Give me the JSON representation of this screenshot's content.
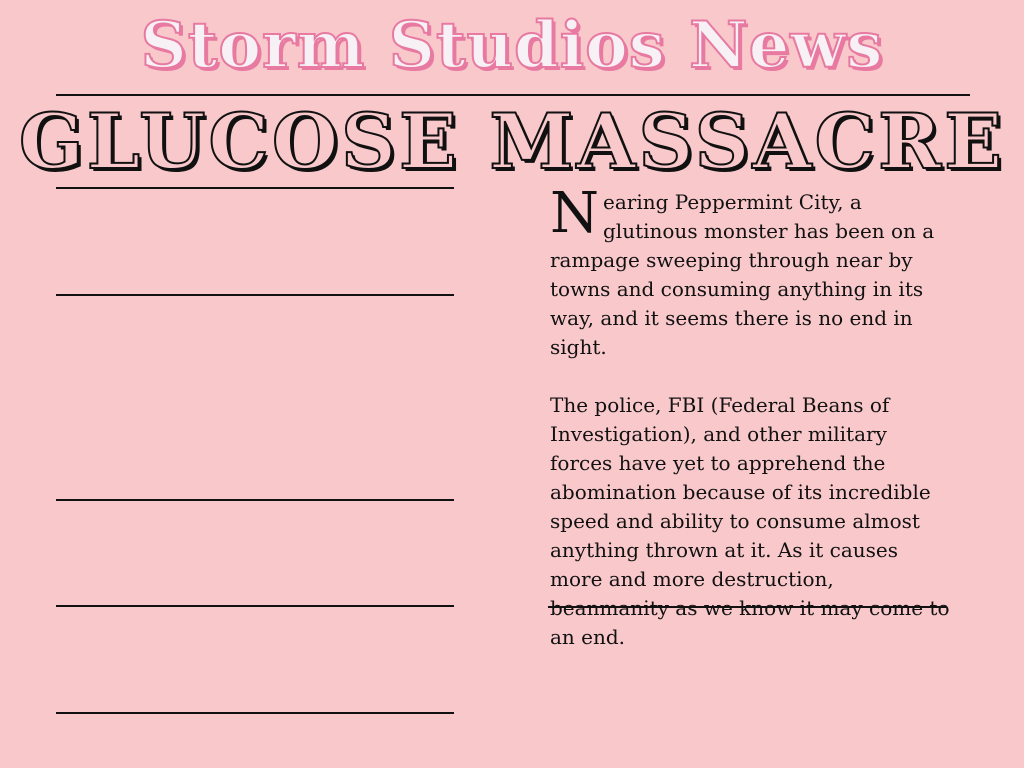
{
  "masthead": {
    "title": "Storm Studios News"
  },
  "headline": {
    "text": "GLUCOSE MASSACRE"
  },
  "article": {
    "dropcap": "N",
    "paragraph1_rest": "earing Peppermint City, a glutinous monster has been on a rampage sweeping through near by towns and consuming anything in its way, and it seems there is no end in sight.",
    "paragraph2": "The police, FBI (Federal Beans of Investigation), and other military forces have yet to apprehend the abomination because of its incredible speed and ability to consume almost anything thrown at it. As it causes more and more destruction, beanmanity as we know it may come to an end."
  },
  "colors": {
    "background": "#f8c8cb",
    "masthead_pink": "#e87aa2",
    "ink": "#111111"
  }
}
